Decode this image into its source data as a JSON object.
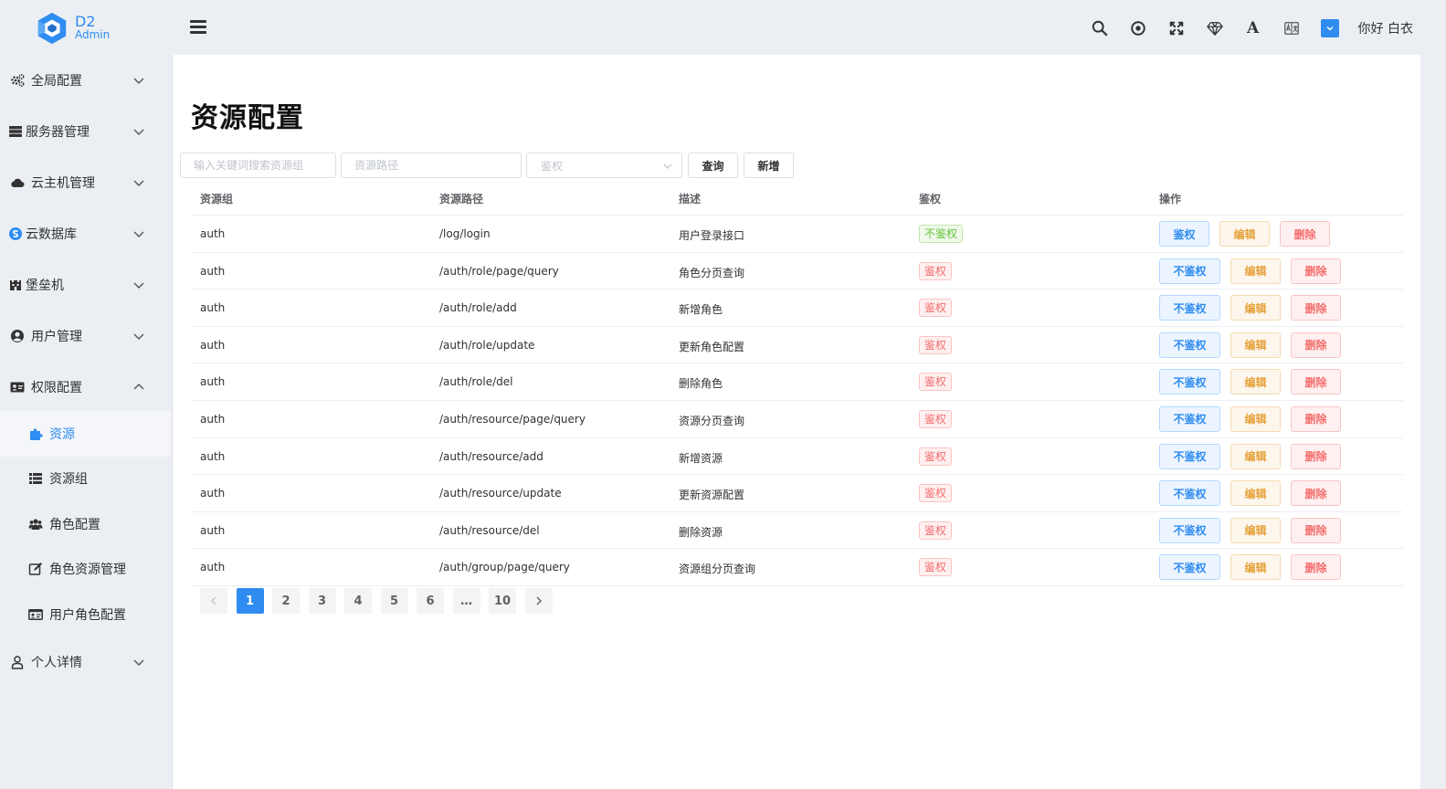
{
  "app": {
    "logo_main": "D2",
    "logo_sub": "Admin"
  },
  "header": {
    "icons": [
      "search-icon",
      "target-icon",
      "fullscreen-icon",
      "diamond-icon",
      "font-icon",
      "translate-icon",
      "theme-color-icon"
    ],
    "font_glyph": "A",
    "greeting": "你好 白衣"
  },
  "sidebar": {
    "items": [
      {
        "label": "全局配置",
        "icon": "gears-icon",
        "expanded": false
      },
      {
        "label": "服务器管理",
        "icon": "server-icon",
        "expanded": false
      },
      {
        "label": "云主机管理",
        "icon": "cloud-icon",
        "expanded": false
      },
      {
        "label": "云数据库",
        "icon": "database-icon",
        "expanded": false
      },
      {
        "label": "堡垒机",
        "icon": "fortress-icon",
        "expanded": false
      },
      {
        "label": "用户管理",
        "icon": "user-circle-icon",
        "expanded": false
      },
      {
        "label": "权限配置",
        "icon": "id-card-icon",
        "expanded": true
      },
      {
        "label": "个人详情",
        "icon": "user-outline-icon",
        "expanded": false
      }
    ],
    "sub_items": [
      {
        "label": "资源",
        "icon": "puzzle-icon",
        "active": true
      },
      {
        "label": "资源组",
        "icon": "list-icon",
        "active": false
      },
      {
        "label": "角色配置",
        "icon": "users-icon",
        "active": false
      },
      {
        "label": "角色资源管理",
        "icon": "edit-icon",
        "active": false
      },
      {
        "label": "用户角色配置",
        "icon": "id-badge-icon",
        "active": false
      }
    ]
  },
  "page": {
    "title": "资源配置",
    "search": {
      "group_placeholder": "输入关键词搜索资源组",
      "path_placeholder": "资源路径",
      "auth_placeholder": "鉴权",
      "query_label": "查询",
      "add_label": "新增"
    }
  },
  "table": {
    "columns": [
      "资源组",
      "资源路径",
      "描述",
      "鉴权",
      "操作"
    ],
    "rows": [
      {
        "group": "auth",
        "path": "/log/login",
        "desc": "用户登录接口",
        "auth": "不鉴权",
        "auth_on": false,
        "toggle": "鉴权",
        "edit": "编辑",
        "delete": "删除"
      },
      {
        "group": "auth",
        "path": "/auth/role/page/query",
        "desc": "角色分页查询",
        "auth": "鉴权",
        "auth_on": true,
        "toggle": "不鉴权",
        "edit": "编辑",
        "delete": "删除"
      },
      {
        "group": "auth",
        "path": "/auth/role/add",
        "desc": "新增角色",
        "auth": "鉴权",
        "auth_on": true,
        "toggle": "不鉴权",
        "edit": "编辑",
        "delete": "删除"
      },
      {
        "group": "auth",
        "path": "/auth/role/update",
        "desc": "更新角色配置",
        "auth": "鉴权",
        "auth_on": true,
        "toggle": "不鉴权",
        "edit": "编辑",
        "delete": "删除"
      },
      {
        "group": "auth",
        "path": "/auth/role/del",
        "desc": "删除角色",
        "auth": "鉴权",
        "auth_on": true,
        "toggle": "不鉴权",
        "edit": "编辑",
        "delete": "删除"
      },
      {
        "group": "auth",
        "path": "/auth/resource/page/query",
        "desc": "资源分页查询",
        "auth": "鉴权",
        "auth_on": true,
        "toggle": "不鉴权",
        "edit": "编辑",
        "delete": "删除"
      },
      {
        "group": "auth",
        "path": "/auth/resource/add",
        "desc": "新增资源",
        "auth": "鉴权",
        "auth_on": true,
        "toggle": "不鉴权",
        "edit": "编辑",
        "delete": "删除"
      },
      {
        "group": "auth",
        "path": "/auth/resource/update",
        "desc": "更新资源配置",
        "auth": "鉴权",
        "auth_on": true,
        "toggle": "不鉴权",
        "edit": "编辑",
        "delete": "删除"
      },
      {
        "group": "auth",
        "path": "/auth/resource/del",
        "desc": "删除资源",
        "auth": "鉴权",
        "auth_on": true,
        "toggle": "不鉴权",
        "edit": "编辑",
        "delete": "删除"
      },
      {
        "group": "auth",
        "path": "/auth/group/page/query",
        "desc": "资源组分页查询",
        "auth": "鉴权",
        "auth_on": true,
        "toggle": "不鉴权",
        "edit": "编辑",
        "delete": "删除"
      }
    ]
  },
  "pagination": {
    "pages": [
      "1",
      "2",
      "3",
      "4",
      "5",
      "6",
      "…",
      "10"
    ],
    "current": "1"
  },
  "colors": {
    "primary": "#2f8cf0",
    "warning": "#e6a23c",
    "danger": "#f56c6c",
    "success": "#67c23a"
  }
}
